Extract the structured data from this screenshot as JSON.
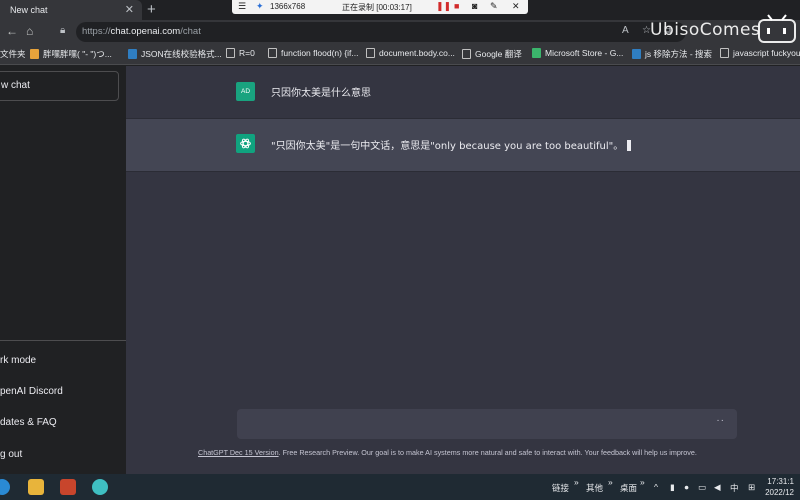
{
  "browser": {
    "tab": {
      "title": "New chat",
      "close": "✕"
    },
    "new_tab": "+",
    "url_prefix": "https://",
    "url_host": "chat.openai.com",
    "url_path": "/chat"
  },
  "recorder": {
    "resolution": "1366x768",
    "status": "正在录制 [00:03:17]"
  },
  "bookmarks": [
    "文件夹",
    "胖嘿胖嘿( \"- \")つ...",
    "JSON在线校验格式...",
    "R=0",
    "function flood(n) {if...",
    "document.body.co...",
    "Google 翻译",
    "Microsoft Store - G...",
    "js 移除方法 - 搜索",
    "javascript fuckyou=..."
  ],
  "sidebar": {
    "new_chat": "w chat",
    "items": [
      "rk mode",
      "penAI Discord",
      "dates & FAQ",
      "g out"
    ]
  },
  "conversation": {
    "user_avatar": "AD",
    "user_message": "只因你太美是什么意思",
    "bot_message": "\"只因你太美\"是一句中文话，意思是\"only because you are too beautiful\"。"
  },
  "composer": {
    "dots": "··"
  },
  "footer": {
    "link": "ChatGPT Dec 15 Version",
    "text": ". Free Research Preview. Our goal is to make AI systems more natural and safe to interact with. Your feedback will help us improve."
  },
  "watermark": "UbisoComes",
  "taskbar": {
    "links": "链接",
    "other": "其他",
    "desktop": "桌面",
    "ime": "中",
    "time": "17:31:1",
    "date": "2022/12"
  },
  "colors": {
    "sidebar_bg": "#202123",
    "main_bg": "#343541",
    "bot_bg": "#444654",
    "accent": "#10a37f"
  }
}
